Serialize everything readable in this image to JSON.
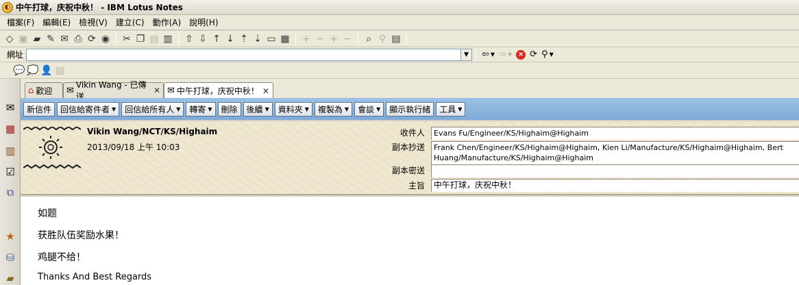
{
  "window": {
    "title": "中午打球，庆祝中秋！ - IBM Lotus Notes"
  },
  "menu": [
    "檔案(F)",
    "編輯(E)",
    "檢視(V)",
    "建立(C)",
    "動作(A)",
    "說明(H)"
  ],
  "address": {
    "label": "網址",
    "value": ""
  },
  "tabs": [
    {
      "label": "歡迎"
    },
    {
      "label": "Vikin Wang - 已傳送"
    },
    {
      "label": "中午打球，庆祝中秋！"
    }
  ],
  "actions": [
    {
      "label": "新信件"
    },
    {
      "label": "回信給寄件者"
    },
    {
      "label": "回信給所有人"
    },
    {
      "label": "轉寄"
    },
    {
      "label": "刪除"
    },
    {
      "label": "後續"
    },
    {
      "label": "資料夾"
    },
    {
      "label": "複製為"
    },
    {
      "label": "會談"
    },
    {
      "label": "顯示執行緒"
    },
    {
      "label": "工具"
    }
  ],
  "message": {
    "sender": "Vikin Wang/NCT/KS/Highaim",
    "datetime": "2013/09/18 上午 10:03",
    "fields": {
      "to_label": "收件人",
      "to": "Evans Fu/Engineer/KS/Highaim@Highaim",
      "cc_label": "副本抄送",
      "cc": "Frank Chen/Engineer/KS/Highaim@Highaim, Kien Li/Manufacture/KS/Highaim@Highaim, Bert Huang/Manufacture/KS/Highaim@Highaim",
      "bcc_label": "副本密送",
      "bcc": "",
      "subject_label": "主旨",
      "subject": "中午打球，庆祝中秋！"
    },
    "body": [
      "如题",
      "获胜队伍奖励水果！",
      "鸡腿不给！",
      "Thanks And Best Regards"
    ]
  }
}
